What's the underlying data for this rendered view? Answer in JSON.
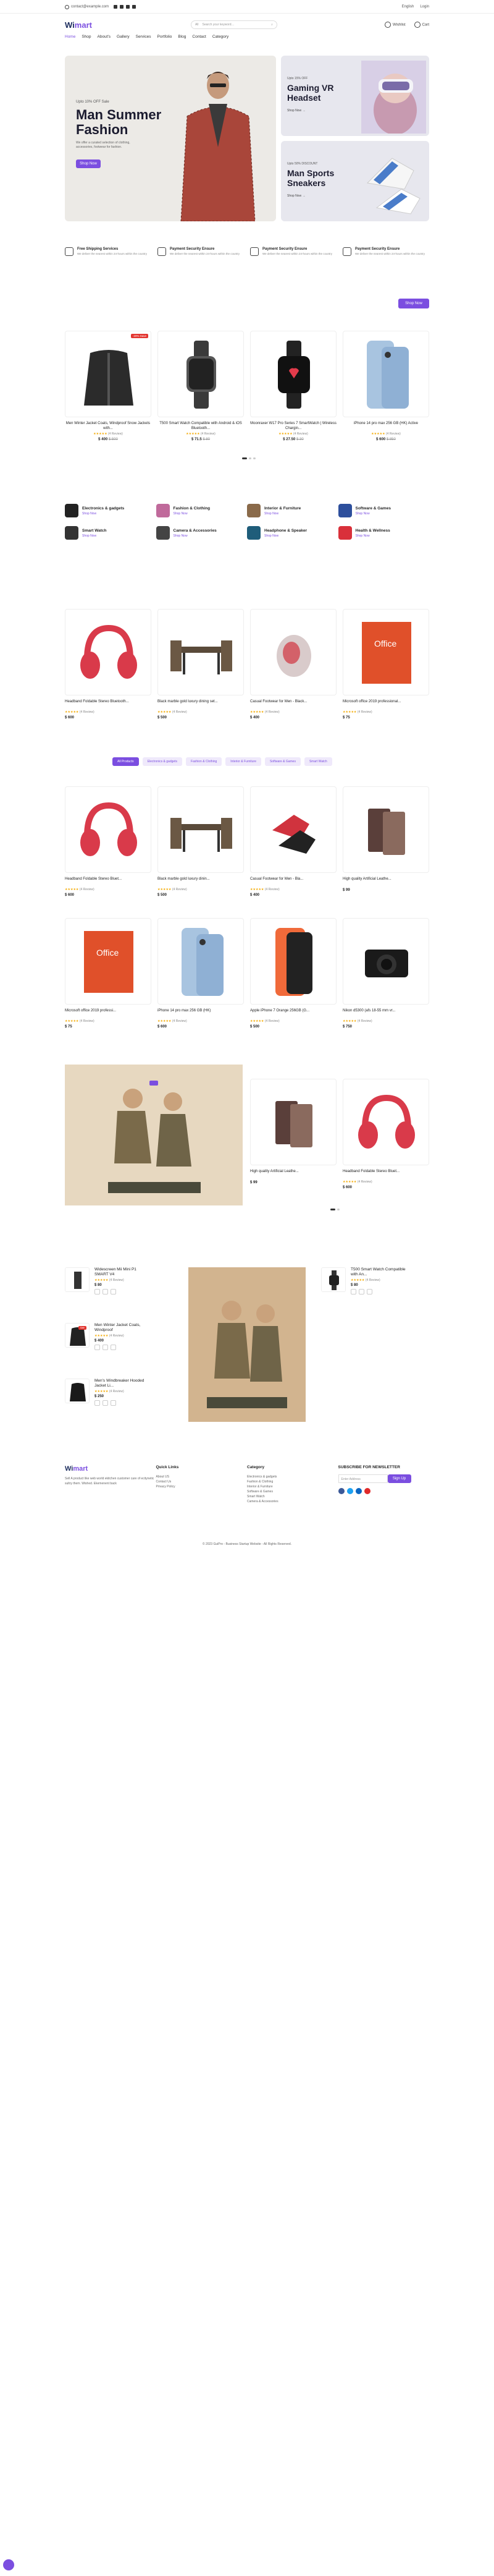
{
  "topbar": {
    "email": "contact@example.com",
    "lang": "English",
    "login": "Login"
  },
  "header": {
    "logo_a": "Wi",
    "logo_b": "mart",
    "search_placeholder": "Search your keyword…",
    "category": "All",
    "wishlist": "Wishlist",
    "cart": "Cart",
    "wishlist_count": "0",
    "cart_count": "0"
  },
  "nav": [
    "Home",
    "Shop",
    "About's",
    "Gallery",
    "Services",
    "Portfolio",
    "Blog",
    "Contact",
    "Category"
  ],
  "hero": {
    "kicker": "Upto 10% OFF Sale",
    "title": "Man Summer Fashion",
    "desc": "We offer a curated selection of clothing, accessories, footwear for fashion.",
    "button": "Shop Now"
  },
  "side_cards": [
    {
      "kicker": "Upto 15% OFF",
      "title": "Gaming VR Headset",
      "link": "Shop Now →"
    },
    {
      "kicker": "Upto 50% DISCOUNT",
      "title": "Man Sports Sneakers",
      "link": "Shop Now →"
    }
  ],
  "features": [
    {
      "title": "Free Shipping Services",
      "desc": "We deliver the nearest within 24-hours within the country"
    },
    {
      "title": "Payment Security Ensure",
      "desc": "We deliver the nearest within 24-hours within the country"
    },
    {
      "title": "Payment Security Ensure",
      "desc": "We deliver the nearest within 24-hours within the country"
    },
    {
      "title": "Payment Security Ensure",
      "desc": "We deliver the nearest within 24-hours within the country"
    }
  ],
  "shop_now": "Shop Now",
  "carousel": [
    {
      "name": "Men Winter Jacket Coats, Windproof Snow Jackets with...",
      "price": "$ 400",
      "old": "$ 500",
      "reviews": "(4 Review)",
      "badge": "-20% Save"
    },
    {
      "name": "T500 Smart Watch Compatible with Android & iOS Bluetooth...",
      "price": "$ 71.5",
      "old": "$ 80",
      "reviews": "(4 Review)",
      "badge": ""
    },
    {
      "name": "Moonraxer W17 Pro Series 7 SmartWatch | Wireless Chargin...",
      "price": "$ 27.50",
      "old": "$ 30",
      "reviews": "(4 Review)",
      "badge": ""
    },
    {
      "name": "iPhone 14 pro max 256 GB (HK) Active",
      "price": "$ 600",
      "old": "$ 850",
      "reviews": "(4 Review)",
      "badge": ""
    }
  ],
  "categories": [
    {
      "name": "Electronics & gadgets",
      "sub": "Shop Now"
    },
    {
      "name": "Fashion & Clothing",
      "sub": "Shop Now"
    },
    {
      "name": "Interior & Furniture",
      "sub": "Shop Now"
    },
    {
      "name": "Software & Games",
      "sub": "Shop Now"
    },
    {
      "name": "Smart Watch",
      "sub": "Shop Now"
    },
    {
      "name": "Camera & Accessories",
      "sub": "Shop Now"
    },
    {
      "name": "Headphone & Speaker",
      "sub": "Shop Now"
    },
    {
      "name": "Health & Wellness",
      "sub": "Shop Now"
    }
  ],
  "featured": [
    {
      "name": "Headband Foldable Stereo Bluetooth...",
      "price": "$ 600",
      "reviews": "(4 Review)"
    },
    {
      "name": "Black marble gold luxury dining set...",
      "price": "$ 500",
      "reviews": "(4 Review)"
    },
    {
      "name": "Casual Footwear for Men - Black...",
      "price": "$ 400",
      "reviews": "(4 Review)"
    },
    {
      "name": "Microsoft office 2019 professional...",
      "price": "$ 75",
      "reviews": "(4 Review)"
    }
  ],
  "tabs": [
    "All Products",
    "Electronics & gadgets",
    "Fashion & Clothing",
    "Interior & Furniture",
    "Software & Games",
    "Smart Watch"
  ],
  "grid1": [
    {
      "name": "Headband Foldable Stereo Bluet...",
      "price": "$ 600",
      "reviews": "(4 Review)"
    },
    {
      "name": "Black marble gold luxury dinin...",
      "price": "$ 500",
      "reviews": "(4 Review)"
    },
    {
      "name": "Casual Footwear for Men - Bla...",
      "price": "$ 400",
      "reviews": "(4 Review)"
    },
    {
      "name": "High quality Artificial Leathe...",
      "price": "$ 99",
      "reviews": ""
    }
  ],
  "grid2": [
    {
      "name": "Microsoft office 2019 professi...",
      "price": "$ 75",
      "reviews": "(4 Review)"
    },
    {
      "name": "iPhone 14 pro max 256 GB (HK)",
      "price": "$ 600",
      "reviews": "(4 Review)"
    },
    {
      "name": "Apple iPhone 7 Orange 256GB (G...",
      "price": "$ 500",
      "reviews": "(4 Review)"
    },
    {
      "name": "Nikon d5300 (afs 18-55 mm vr...",
      "price": "$ 750",
      "reviews": "(4 Review)"
    }
  ],
  "banner_products": [
    {
      "name": "High quality Artificial Leathe...",
      "price": "$ 99",
      "reviews": ""
    },
    {
      "name": "Headband Foldable Stereo Bluet...",
      "price": "$ 600",
      "reviews": "(4 Review)"
    }
  ],
  "bottom_left": [
    {
      "name": "Widescreen Mii Mini P1 SMART V4",
      "price": "$ 80",
      "reviews": "(4 Review)"
    },
    {
      "name": "Men Winter Jacket Coats, Windproof",
      "price": "$ 400",
      "reviews": "(4 Review)"
    },
    {
      "name": "Men's Windbreaker Hooded Jacket Li...",
      "price": "$ 250",
      "reviews": "(4 Review)"
    }
  ],
  "bottom_right": {
    "name": "T500 Smart Watch Compatible with An...",
    "price": "$ 80",
    "reviews": "(4 Review)"
  },
  "footer": {
    "about": "Sell A product like web world ekitchen customer care of ecitynetic sultry them. Wished. Ekemenent back",
    "quick_title": "Quick Links",
    "quick": [
      "About US",
      "Contact Us",
      "Privacy Policy"
    ],
    "cat_title": "Category",
    "cats": [
      "Electronics & gadgets",
      "Fashion & Clothing",
      "Interior & Furniture",
      "Software & Games",
      "Smart Watch",
      "Camera & Accessories"
    ],
    "nl_title": "SUBSCRIBE FOR NEWSLETTER",
    "nl_placeholder": "Enter Address",
    "nl_button": "Sign Up"
  },
  "copyright": "© 2023 GuiPro - Business Startup Website - All Rights Reserved.",
  "colors": {
    "accent": "#7b4ee0",
    "navy": "#1a2b5c",
    "star": "#f3a900"
  }
}
